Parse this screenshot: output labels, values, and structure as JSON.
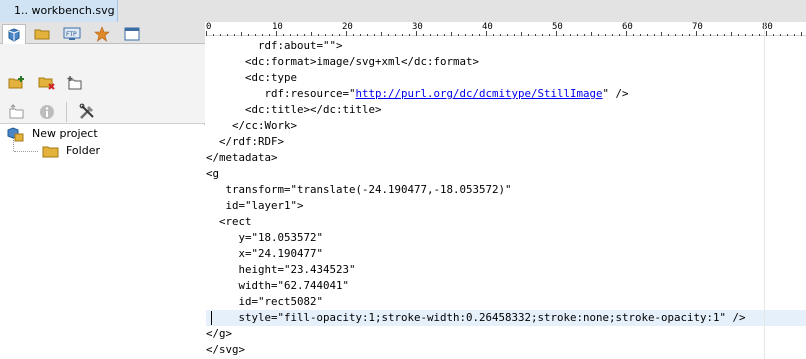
{
  "document_tab": {
    "label": "1.. workbench.svg"
  },
  "sidebar": {
    "tabs": [
      {
        "icon": "project-cube-icon",
        "active": true
      },
      {
        "icon": "folder-icon",
        "active": false
      },
      {
        "icon": "ftp-icon",
        "active": false
      },
      {
        "icon": "star-icon",
        "active": false
      },
      {
        "icon": "window-icon",
        "active": false
      }
    ],
    "toolbar": [
      {
        "icon": "new-project-folder-icon"
      },
      {
        "icon": "delete-folder-icon"
      },
      {
        "icon": "add-item-icon"
      },
      {
        "icon": "up-folder-icon"
      },
      {
        "icon": "info-icon"
      },
      {
        "icon": "settings-tools-icon"
      }
    ],
    "tree": {
      "project_label": "New project",
      "folder_label": "Folder"
    }
  },
  "ruler": {
    "labels": [
      "0",
      "10",
      "20",
      "30",
      "40",
      "50",
      "60",
      "70",
      "80"
    ]
  },
  "code_lines": [
    "        rdf:about=\"\">",
    "      <dc:format>image/svg+xml</dc:format>",
    "      <dc:type",
    "         rdf:resource=\"",
    "      <dc:title></dc:title>",
    "    </cc:Work>",
    "  </rdf:RDF>",
    "</metadata>",
    "<g",
    "   transform=\"translate(-24.190477,-18.053572)\"",
    "   id=\"layer1\">",
    "  <rect",
    "     y=\"18.053572\"",
    "     x=\"24.190477\"",
    "     height=\"23.434523\"",
    "     width=\"62.744041\"",
    "     id=\"rect5082\"",
    "     style=\"fill-opacity:1;stroke-width:0.26458332;stroke:none;stroke-opacity:1\" />",
    "</g>",
    "</svg>"
  ],
  "code_link": {
    "href_text": "http://purl.org/dc/dcmitype/StillImage",
    "after": "\" />"
  },
  "colors": {
    "tab_active": "#cfe3f5",
    "current_line": "#e6f0fb",
    "link": "#0000ee"
  }
}
